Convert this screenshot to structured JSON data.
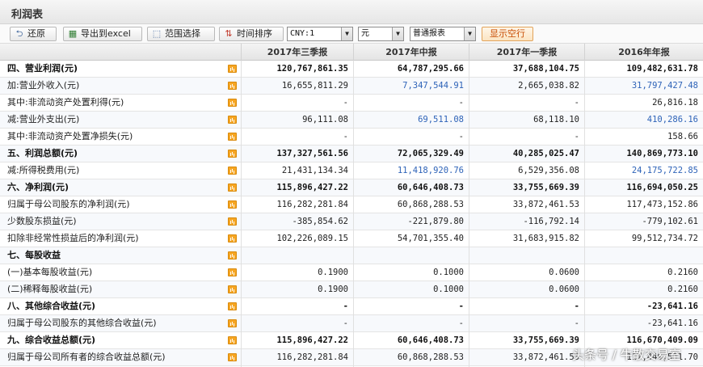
{
  "window": {
    "title": "利润表"
  },
  "toolbar": {
    "restore": "还原",
    "export": "导出到excel",
    "range": "范围选择",
    "sort": "时间排序",
    "currency": "CNY:1",
    "unit": "元",
    "report_type": "普通报表",
    "show_empty": "显示空行"
  },
  "columns": [
    "2017年三季报",
    "2017年中报",
    "2017年一季报",
    "2016年年报"
  ],
  "rows": [
    {
      "label": "四、营业利润(元)",
      "bold": true,
      "values": [
        "120,767,861.35",
        "64,787,295.66",
        "37,688,104.75",
        "109,482,631.78"
      ],
      "blue": [
        false,
        false,
        false,
        false
      ]
    },
    {
      "label": "加:营业外收入(元)",
      "bold": false,
      "values": [
        "16,655,811.29",
        "7,347,544.91",
        "2,665,038.82",
        "31,797,427.48"
      ],
      "blue": [
        false,
        true,
        false,
        true
      ]
    },
    {
      "label": "其中:非流动资产处置利得(元)",
      "bold": false,
      "values": [
        "-",
        "-",
        "-",
        "26,816.18"
      ],
      "blue": [
        false,
        false,
        false,
        false
      ]
    },
    {
      "label": "减:营业外支出(元)",
      "bold": false,
      "values": [
        "96,111.08",
        "69,511.08",
        "68,118.10",
        "410,286.16"
      ],
      "blue": [
        false,
        true,
        false,
        true
      ]
    },
    {
      "label": "其中:非流动资产处置净损失(元)",
      "bold": false,
      "values": [
        "-",
        "-",
        "-",
        "158.66"
      ],
      "blue": [
        false,
        false,
        false,
        false
      ]
    },
    {
      "label": "五、利润总额(元)",
      "bold": true,
      "values": [
        "137,327,561.56",
        "72,065,329.49",
        "40,285,025.47",
        "140,869,773.10"
      ],
      "blue": [
        false,
        false,
        false,
        false
      ]
    },
    {
      "label": "减:所得税费用(元)",
      "bold": false,
      "values": [
        "21,431,134.34",
        "11,418,920.76",
        "6,529,356.08",
        "24,175,722.85"
      ],
      "blue": [
        false,
        true,
        false,
        true
      ]
    },
    {
      "label": "六、净利润(元)",
      "bold": true,
      "values": [
        "115,896,427.22",
        "60,646,408.73",
        "33,755,669.39",
        "116,694,050.25"
      ],
      "blue": [
        false,
        false,
        false,
        false
      ]
    },
    {
      "label": "归属于母公司股东的净利润(元)",
      "bold": false,
      "values": [
        "116,282,281.84",
        "60,868,288.53",
        "33,872,461.53",
        "117,473,152.86"
      ],
      "blue": [
        false,
        false,
        false,
        false
      ]
    },
    {
      "label": "少数股东损益(元)",
      "bold": false,
      "values": [
        "-385,854.62",
        "-221,879.80",
        "-116,792.14",
        "-779,102.61"
      ],
      "blue": [
        false,
        false,
        false,
        false
      ]
    },
    {
      "label": "扣除非经常性损益后的净利润(元)",
      "bold": false,
      "values": [
        "102,226,089.15",
        "54,701,355.40",
        "31,683,915.82",
        "99,512,734.72"
      ],
      "blue": [
        false,
        false,
        false,
        false
      ]
    },
    {
      "label": "七、每股收益",
      "bold": true,
      "values": [
        "",
        "",
        "",
        ""
      ],
      "blue": [
        false,
        false,
        false,
        false
      ]
    },
    {
      "label": "(一)基本每股收益(元)",
      "bold": false,
      "values": [
        "0.1900",
        "0.1000",
        "0.0600",
        "0.2160"
      ],
      "blue": [
        false,
        false,
        false,
        false
      ]
    },
    {
      "label": "(二)稀释每股收益(元)",
      "bold": false,
      "values": [
        "0.1900",
        "0.1000",
        "0.0600",
        "0.2160"
      ],
      "blue": [
        false,
        false,
        false,
        false
      ]
    },
    {
      "label": "八、其他综合收益(元)",
      "bold": true,
      "values": [
        "-",
        "-",
        "-",
        "-23,641.16"
      ],
      "blue": [
        false,
        true,
        false,
        true
      ]
    },
    {
      "label": "归属于母公司股东的其他综合收益(元)",
      "bold": false,
      "values": [
        "-",
        "-",
        "-",
        "-23,641.16"
      ],
      "blue": [
        false,
        false,
        false,
        false
      ]
    },
    {
      "label": "九、综合收益总额(元)",
      "bold": true,
      "values": [
        "115,896,427.22",
        "60,646,408.73",
        "33,755,669.39",
        "116,670,409.09"
      ],
      "blue": [
        false,
        false,
        false,
        false
      ]
    },
    {
      "label": "归属于母公司所有者的综合收益总额(元)",
      "bold": false,
      "values": [
        "116,282,281.84",
        "60,868,288.53",
        "33,872,461.53",
        "117,449,511.70"
      ],
      "blue": [
        false,
        false,
        false,
        false
      ]
    }
  ],
  "watermark": "头条号 / 牛散交易室",
  "colors": {
    "link_blue": "#2e63b8",
    "accent_orange": "#f6a623",
    "show_btn_text": "#c84b00"
  }
}
